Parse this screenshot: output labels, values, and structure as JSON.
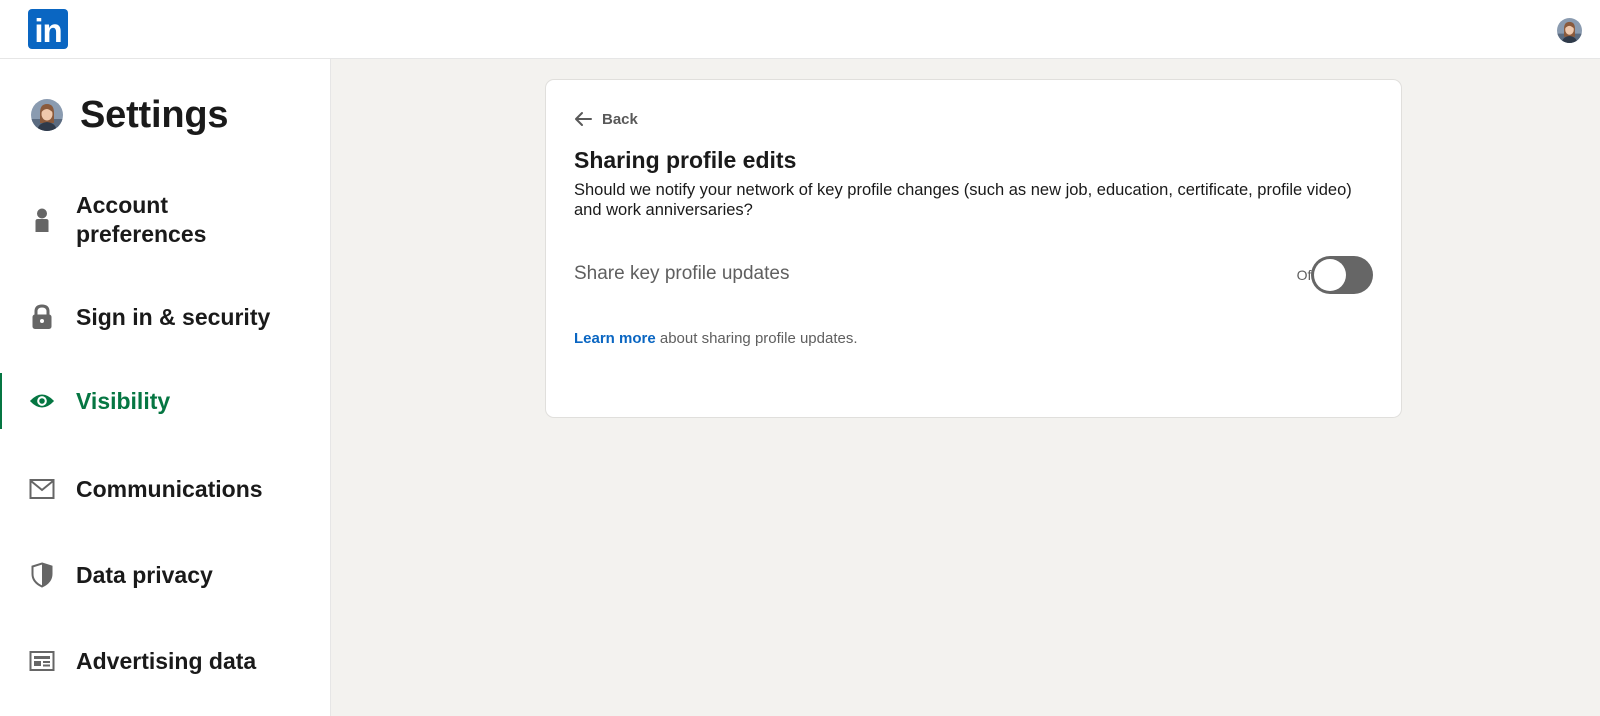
{
  "header": {
    "logo_text": "in"
  },
  "sidebar": {
    "title": "Settings",
    "items": [
      {
        "label_line1": "Account",
        "label_line2": "preferences",
        "icon": "person-icon"
      },
      {
        "label": "Sign in & security",
        "icon": "lock-icon"
      },
      {
        "label": "Visibility",
        "icon": "eye-icon",
        "active": true
      },
      {
        "label": "Communications",
        "icon": "envelope-icon"
      },
      {
        "label": "Data privacy",
        "icon": "shield-icon"
      },
      {
        "label": "Advertising data",
        "icon": "ad-card-icon"
      }
    ]
  },
  "card": {
    "back_label": "Back",
    "title": "Sharing profile edits",
    "description": "Should we notify your network of key profile changes (such as new job, education, certificate, profile video) and work anniversaries?",
    "setting_label": "Share key profile updates",
    "toggle_state": "Off",
    "toggle_on": false,
    "learn_more_link": "Learn more",
    "learn_more_rest": " about sharing profile updates."
  },
  "colors": {
    "brand": "#0a66c2",
    "active": "#057642",
    "background": "#f3f2ef",
    "toggle_off": "#666666"
  }
}
